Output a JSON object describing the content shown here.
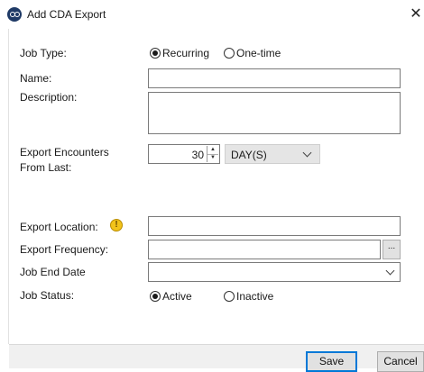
{
  "window": {
    "title": "Add CDA Export",
    "close_glyph": "✕"
  },
  "form": {
    "job_type": {
      "label": "Job Type:",
      "options": [
        "Recurring",
        "One-time"
      ],
      "selected": "Recurring"
    },
    "name": {
      "label": "Name:",
      "value": ""
    },
    "description": {
      "label": "Description:",
      "value": ""
    },
    "export_encounters": {
      "label_line1": "Export Encounters",
      "label_line2": "From Last:",
      "value": "30",
      "unit": "DAY(S)"
    },
    "export_location": {
      "label": "Export Location:",
      "value": "",
      "icon": "info-icon"
    },
    "export_frequency": {
      "label": "Export Frequency:",
      "value": "",
      "browse_label": "..."
    },
    "job_end_date": {
      "label": "Job End Date",
      "value": ""
    },
    "job_status": {
      "label": "Job Status:",
      "options": [
        "Active",
        "Inactive"
      ],
      "selected": "Active"
    }
  },
  "buttons": {
    "save": "Save",
    "cancel": "Cancel"
  },
  "icons": {
    "app": "app-logo-icon",
    "info": "info-icon",
    "spin_up": "▲",
    "spin_down": "▼",
    "info_glyph": "!"
  },
  "colors": {
    "accent": "#0078d7",
    "info_icon": "#f2c31a",
    "select_bg": "#e5e5e5"
  }
}
